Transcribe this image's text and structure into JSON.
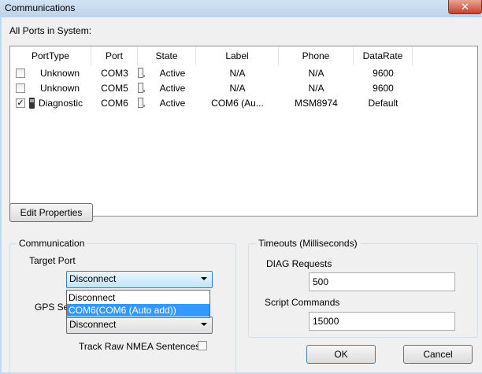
{
  "window": {
    "title": "Communications",
    "close_glyph": "✕"
  },
  "ports_label": "All Ports in System:",
  "table": {
    "columns": [
      "PortType",
      "Port",
      "State",
      "Label",
      "Phone",
      "DataRate"
    ],
    "rows": [
      {
        "checked": false,
        "port_type": "Unknown",
        "port": "COM3",
        "state": "Active",
        "label": "N/A",
        "phone": "N/A",
        "data_rate": "9600",
        "icon": ""
      },
      {
        "checked": false,
        "port_type": "Unknown",
        "port": "COM5",
        "state": "Active",
        "label": "N/A",
        "phone": "N/A",
        "data_rate": "9600",
        "icon": ""
      },
      {
        "checked": true,
        "port_type": "Diagnostic",
        "port": "COM6",
        "state": "Active",
        "label": "COM6 (Au...",
        "phone": "MSM8974",
        "data_rate": "Default",
        "icon": "phone-icon"
      }
    ]
  },
  "edit_properties_label": "Edit Properties",
  "communication": {
    "group_title": "Communication",
    "target_port_label": "Target Port",
    "target_port_value": "Disconnect",
    "dropdown_options": [
      "Disconnect",
      "COM6(COM6 (Auto add))"
    ],
    "dropdown_selected_index": 1,
    "gps_label": "GPS Ser",
    "gps_value": "Disconnect",
    "track_nmea_label": "Track Raw NMEA Sentences",
    "track_nmea_checked": false
  },
  "timeouts": {
    "group_title": "Timeouts (Milliseconds)",
    "diag_label": "DIAG Requests",
    "diag_value": "500",
    "script_label": "Script Commands",
    "script_value": "15000"
  },
  "ok_label": "OK",
  "cancel_label": "Cancel",
  "colors": {
    "selection": "#3399ff",
    "close_button": "#c7432b"
  }
}
